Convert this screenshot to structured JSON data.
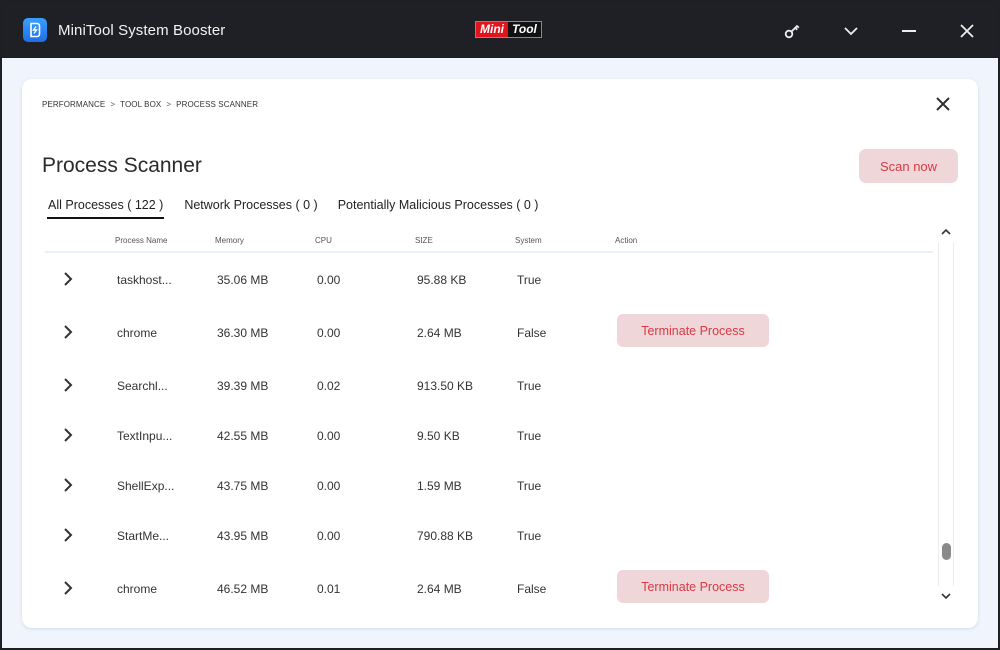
{
  "app": {
    "title": "MiniTool System Booster",
    "brand_left": "Mini",
    "brand_right": "Tool",
    "icons": {
      "app": "app-logo-icon",
      "key": "key-icon",
      "menu": "chevron-down-icon",
      "minimize": "minimize-icon",
      "close": "close-icon"
    }
  },
  "breadcrumb": {
    "items": [
      "PERFORMANCE",
      "TOOL BOX",
      "PROCESS SCANNER"
    ],
    "separator": ">"
  },
  "page": {
    "title": "Process Scanner",
    "scan_button": "Scan now"
  },
  "tabs": [
    {
      "label": "All Processes ( 122 )",
      "active": true
    },
    {
      "label": "Network Processes ( 0 )",
      "active": false
    },
    {
      "label": "Potentially Malicious Processes ( 0 )",
      "active": false
    }
  ],
  "table": {
    "columns": [
      "Process Name",
      "Memory",
      "CPU",
      "SIZE",
      "System",
      "Action"
    ],
    "rows": [
      {
        "name": "taskhost...",
        "memory": "35.06 MB",
        "cpu": "0.00",
        "size": "95.88 KB",
        "system": "True",
        "action": ""
      },
      {
        "name": "chrome",
        "memory": "36.30 MB",
        "cpu": "0.00",
        "size": "2.64 MB",
        "system": "False",
        "action": "Terminate Process"
      },
      {
        "name": "Searchl...",
        "memory": "39.39 MB",
        "cpu": "0.02",
        "size": "913.50 KB",
        "system": "True",
        "action": ""
      },
      {
        "name": "TextInpu...",
        "memory": "42.55 MB",
        "cpu": "0.00",
        "size": "9.50 KB",
        "system": "True",
        "action": ""
      },
      {
        "name": "ShellExp...",
        "memory": "43.75 MB",
        "cpu": "0.00",
        "size": "1.59 MB",
        "system": "True",
        "action": ""
      },
      {
        "name": "StartMe...",
        "memory": "43.95 MB",
        "cpu": "0.00",
        "size": "790.88 KB",
        "system": "True",
        "action": ""
      },
      {
        "name": "chrome",
        "memory": "46.52 MB",
        "cpu": "0.01",
        "size": "2.64 MB",
        "system": "False",
        "action": "Terminate Process"
      }
    ]
  },
  "scrollbar": {
    "position_fraction": 0.92
  },
  "colors": {
    "accent_text": "#d83a44",
    "accent_bg": "#efd6d8",
    "titlebar": "#1f2025",
    "content_bg": "#eff4fd"
  }
}
